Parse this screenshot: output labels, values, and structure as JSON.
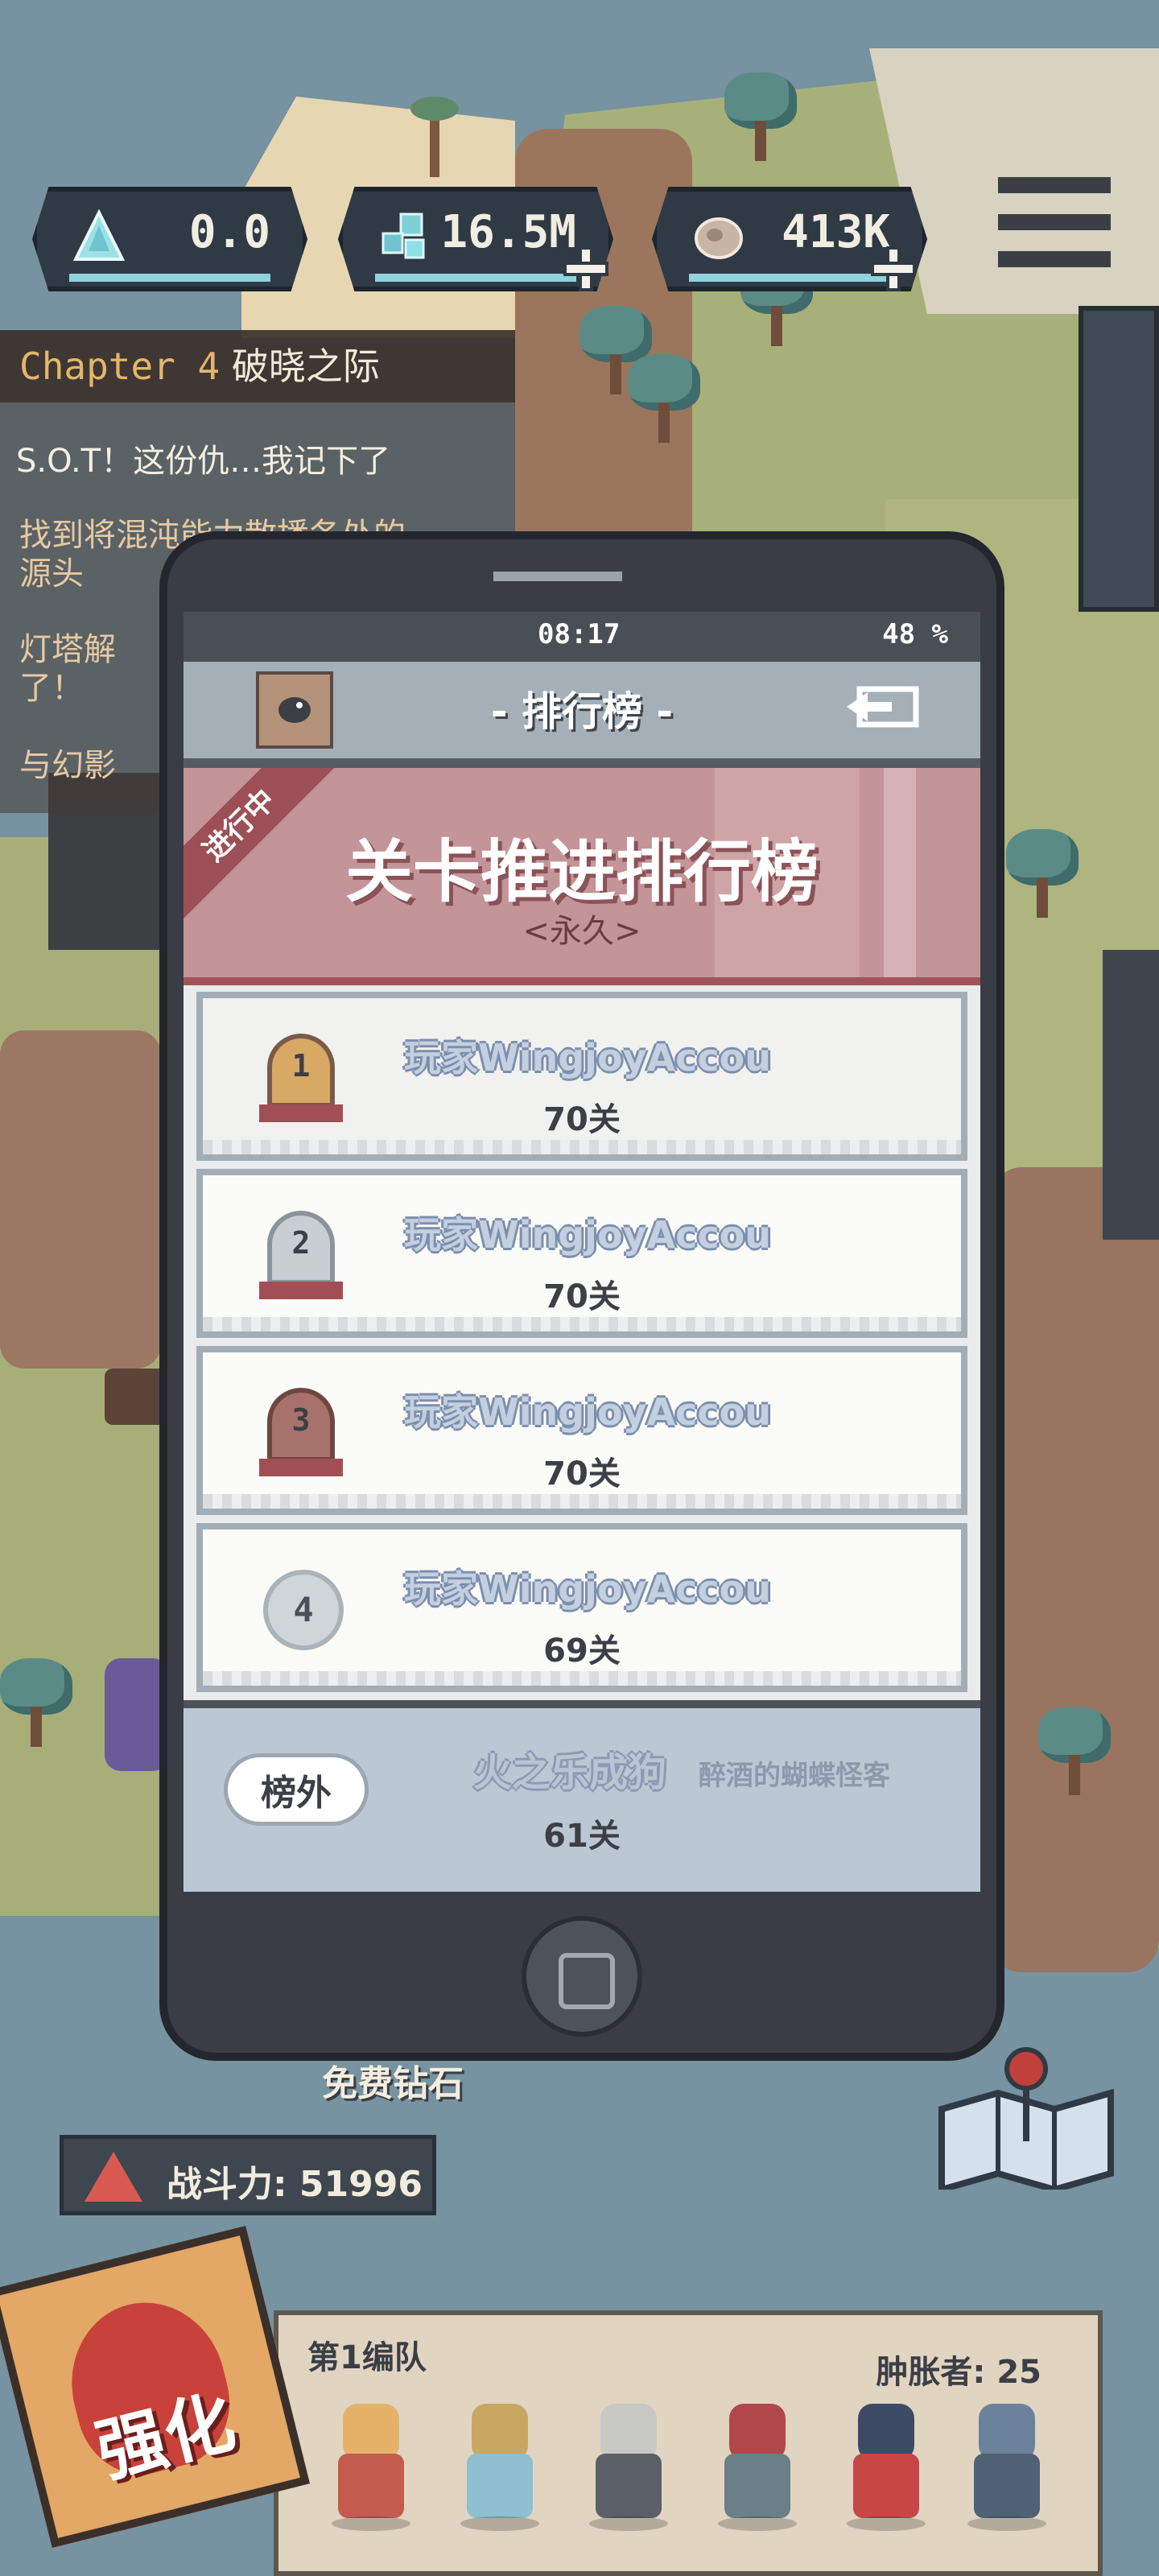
{
  "hud": {
    "crystal": "0.0",
    "gems": "16.5M",
    "ore": "413K"
  },
  "questlog": {
    "chapter_prefix": "Chapter 4",
    "chapter_title": "破晓之际",
    "quests": [
      "S.O.T！这份仇…我记下了",
      "找到将混沌能力散播各处的",
      "源头",
      "灯塔解",
      "了！",
      "与幻影"
    ]
  },
  "phone": {
    "time": "08:17",
    "battery": "48 %",
    "title": "- 排行榜 -",
    "ribbon": "进行中",
    "leaderboard_name": "关卡推进排行榜",
    "leaderboard_period": "<永久>",
    "entries": [
      {
        "rank": "1",
        "name": "玩家WingjoyAccou",
        "level": "70关",
        "medal": "gold"
      },
      {
        "rank": "2",
        "name": "玩家WingjoyAccou",
        "level": "70关",
        "medal": "silver"
      },
      {
        "rank": "3",
        "name": "玩家WingjoyAccou",
        "level": "70关",
        "medal": "bronze"
      },
      {
        "rank": "4",
        "name": "玩家WingjoyAccou",
        "level": "69关",
        "medal": "none"
      }
    ],
    "self": {
      "rank_label": "榜外",
      "name": "火之乐成狗",
      "title": "醉酒的蝴蝶怪客",
      "level": "61关"
    }
  },
  "bottom": {
    "free_gem": "免费钻石",
    "power_label": "战斗力: 51996",
    "strengthen": "强化",
    "team_name": "第1编队",
    "swell_label": "肿胀者: 25"
  },
  "colors": {
    "gold_medal": "#d8a865",
    "silver_medal": "#c9ced3",
    "bronze_medal": "#a7726b",
    "banner": "#c39599"
  }
}
